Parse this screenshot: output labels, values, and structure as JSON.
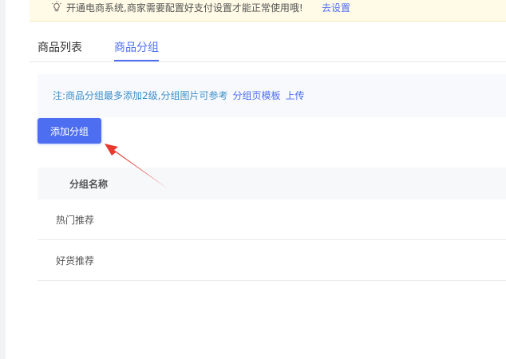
{
  "notice": {
    "text": "开通电商系统,商家需要配置好支付设置才能正常使用哦!",
    "link": "去设置",
    "icon": "lightbulb-icon"
  },
  "tabs": [
    {
      "label": "商品列表",
      "active": false
    },
    {
      "label": "商品分组",
      "active": true
    }
  ],
  "tip": {
    "text": "注:商品分组最多添加2级,分组图片可参考",
    "template_link": "分组页模板",
    "upload_link": "上传"
  },
  "add_button": {
    "label": "添加分组"
  },
  "table": {
    "header": "分组名称",
    "rows": [
      "热门推荐",
      "好货推荐"
    ]
  },
  "colors": {
    "accent": "#4e6ef2",
    "annotation_arrow": "#e8392f",
    "notice_bg": "#fffbe6"
  }
}
